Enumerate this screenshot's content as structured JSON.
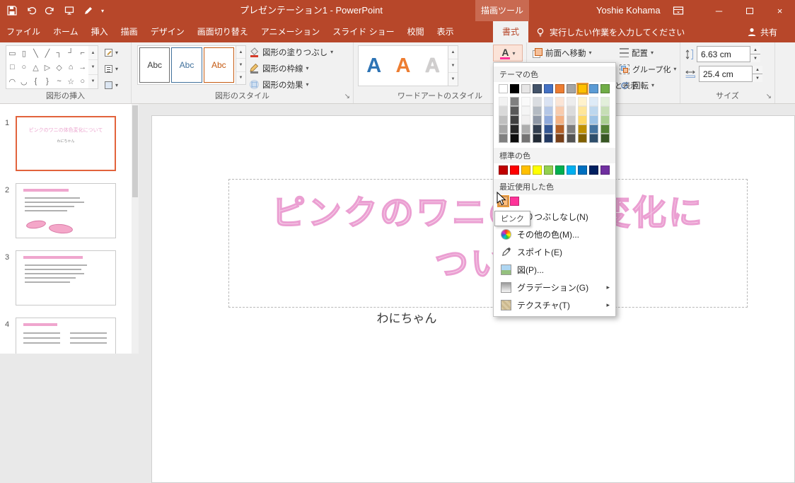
{
  "colors": {
    "titlebar": "#b7472a",
    "contextual_header": "#c96a51",
    "ribbon_bg": "#f1f1f1",
    "selection_orange": "#e2633c",
    "wordart_fill": "#f6d4ea",
    "wordart_outline": "#eb9fd2"
  },
  "titlebar": {
    "title": "プレゼンテーション1 - PowerPoint",
    "contextual_group": "描画ツール",
    "user": "Yoshie Kohama"
  },
  "tabs": {
    "items": [
      {
        "key": "file",
        "label": "ファイル"
      },
      {
        "key": "home",
        "label": "ホーム"
      },
      {
        "key": "insert",
        "label": "挿入"
      },
      {
        "key": "draw",
        "label": "描画"
      },
      {
        "key": "design",
        "label": "デザイン"
      },
      {
        "key": "transitions",
        "label": "画面切り替え"
      },
      {
        "key": "animations",
        "label": "アニメーション"
      },
      {
        "key": "slide-show",
        "label": "スライド ショー"
      },
      {
        "key": "review",
        "label": "校閲"
      },
      {
        "key": "view",
        "label": "表示"
      }
    ],
    "contextual": {
      "key": "format",
      "label": "書式"
    },
    "search_placeholder": "実行したい作業を入力してください",
    "share_label": "共有"
  },
  "ribbon": {
    "insert_shapes": {
      "label": "図形の挿入",
      "rows": [
        [
          "▭",
          "▯",
          "╲",
          "╱",
          "┐",
          "┘",
          "⌐"
        ],
        [
          "□",
          "○",
          "△",
          "▷",
          "◇",
          "⌂",
          "→"
        ],
        [
          "◠",
          "◡",
          "{",
          "}",
          "~",
          "☆",
          "○"
        ]
      ]
    },
    "shape_styles": {
      "label": "図形のスタイル",
      "samples": [
        {
          "text": "Abc",
          "color": "#3b3b3b",
          "border": "#6e6e6e"
        },
        {
          "text": "Abc",
          "color": "#41719c",
          "border": "#41719c"
        },
        {
          "text": "Abc",
          "color": "#c55a11",
          "border": "#c55a11"
        }
      ],
      "fill": "図形の塗りつぶし",
      "outline": "図形の枠線",
      "effects": "図形の効果"
    },
    "wordart_styles": {
      "label": "ワードアートのスタイル",
      "letters": [
        {
          "char": "A",
          "color": "#2e74b5"
        },
        {
          "char": "A",
          "color": "#ed7d31"
        },
        {
          "char": "A",
          "color": "#d0cece"
        }
      ],
      "text_fill_letter": "A",
      "text_fill_bar_color": "#ff3399"
    },
    "arrange": {
      "label": "配置",
      "bring_forward": "前面へ移動",
      "selection_pane": "オブジェクトの選択と表示",
      "align": "配置",
      "group": "グループ化",
      "rotate": "回転"
    },
    "size": {
      "label": "サイズ",
      "height_value": "6.63 cm",
      "width_value": "25.4 cm"
    }
  },
  "color_menu": {
    "sections": {
      "theme": "テーマの色",
      "standard": "標準の色",
      "recent": "最近使用した色"
    },
    "theme_colors": [
      "#ffffff",
      "#000000",
      "#e7e6e6",
      "#44546a",
      "#4472c4",
      "#ed7d31",
      "#a5a5a5",
      "#ffc000",
      "#5b9bd5",
      "#70ad47"
    ],
    "selected_theme_index": 7,
    "tint_levels": [
      0.8,
      0.6,
      0.4,
      -0.25,
      -0.5
    ],
    "standard_colors": [
      "#c00000",
      "#ff0000",
      "#ffc000",
      "#ffff00",
      "#92d050",
      "#00b050",
      "#00b0f0",
      "#0070c0",
      "#002060",
      "#7030a0"
    ],
    "recent_colors": [
      "#ffbe7d",
      "#ff3399"
    ],
    "hovered_recent_index": 0,
    "items": [
      {
        "key": "no-fill",
        "label": "塗りつぶしなし(N)",
        "icon": "none"
      },
      {
        "key": "more-colors",
        "label": "その他の色(M)...",
        "icon": "palette"
      },
      {
        "key": "eyedropper",
        "label": "スポイト(E)",
        "icon": "eyedropper"
      },
      {
        "key": "picture",
        "label": "図(P)...",
        "icon": "picture"
      },
      {
        "key": "gradient",
        "label": "グラデーション(G)",
        "icon": "gradient",
        "submenu": true
      },
      {
        "key": "texture",
        "label": "テクスチャ(T)",
        "icon": "texture",
        "submenu": true
      }
    ],
    "tooltip": "ピンク"
  },
  "slides_panel": {
    "slides": [
      {
        "num": "1",
        "selected": true,
        "kind": "title"
      },
      {
        "num": "2",
        "selected": false,
        "kind": "bullets-shapes"
      },
      {
        "num": "3",
        "selected": false,
        "kind": "bullets"
      },
      {
        "num": "4",
        "selected": false,
        "kind": "two-column"
      }
    ]
  },
  "canvas": {
    "title_line1": "ピンクのワニの体色変化に",
    "title_line2": "ついて",
    "subtitle": "わにちゃん"
  }
}
